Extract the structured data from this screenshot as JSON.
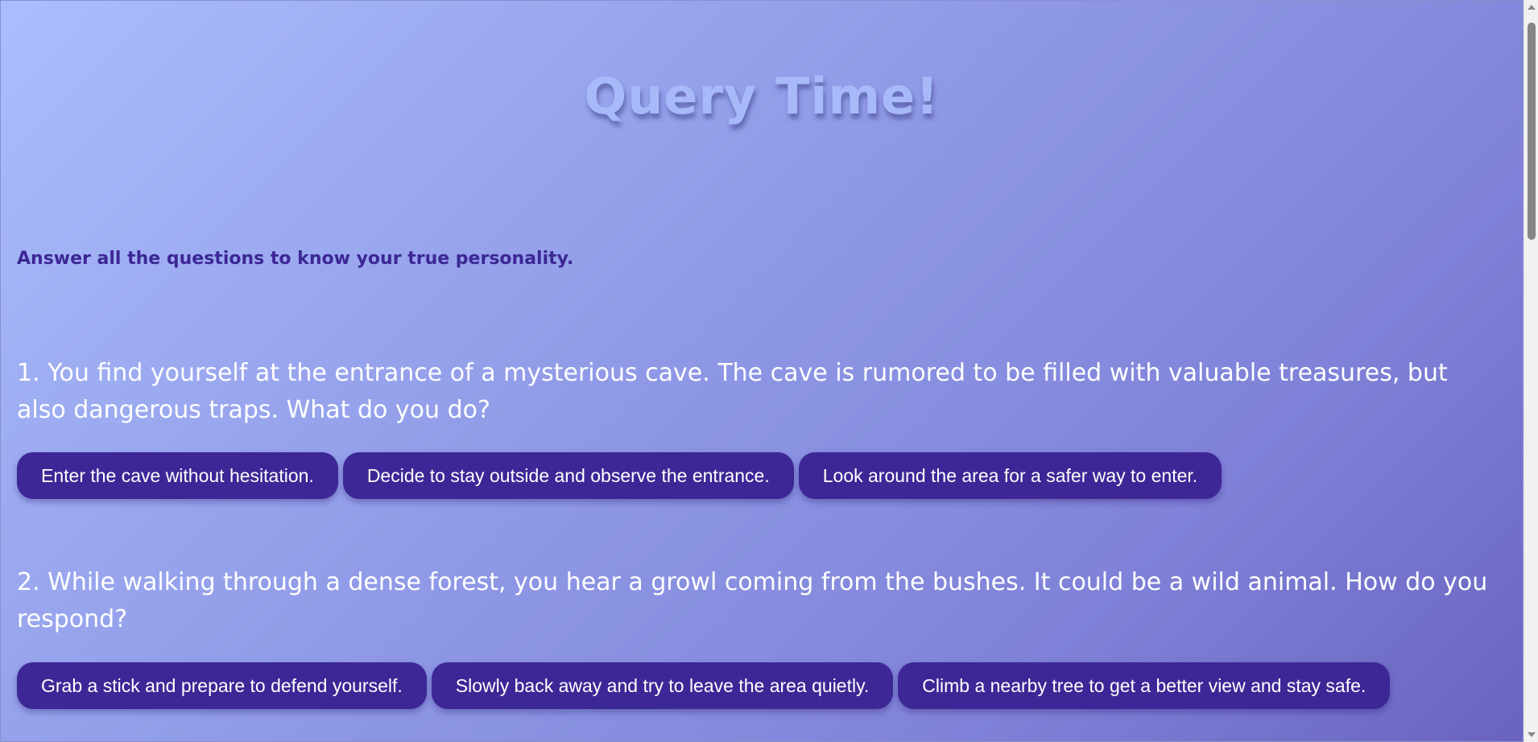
{
  "title": "Query Time!",
  "subtitle": "Answer all the questions to know your true personality.",
  "questions": [
    {
      "text": "1. You find yourself at the entrance of a mysterious cave. The cave is rumored to be filled with valuable treasures, but also dangerous traps. What do you do?",
      "options": [
        "Enter the cave without hesitation.",
        "Decide to stay outside and observe the entrance.",
        "Look around the area for a safer way to enter."
      ]
    },
    {
      "text": "2. While walking through a dense forest, you hear a growl coming from the bushes. It could be a wild animal. How do you respond?",
      "options": [
        "Grab a stick and prepare to defend yourself.",
        "Slowly back away and try to leave the area quietly.",
        "Climb a nearby tree to get a better view and stay safe."
      ]
    }
  ],
  "colors": {
    "button_bg": "#3d2796",
    "title": "#a8b9f9",
    "subtitle": "#3c2795",
    "question_text": "#ffffff"
  },
  "scroll": {
    "position_fraction": 0.0
  }
}
